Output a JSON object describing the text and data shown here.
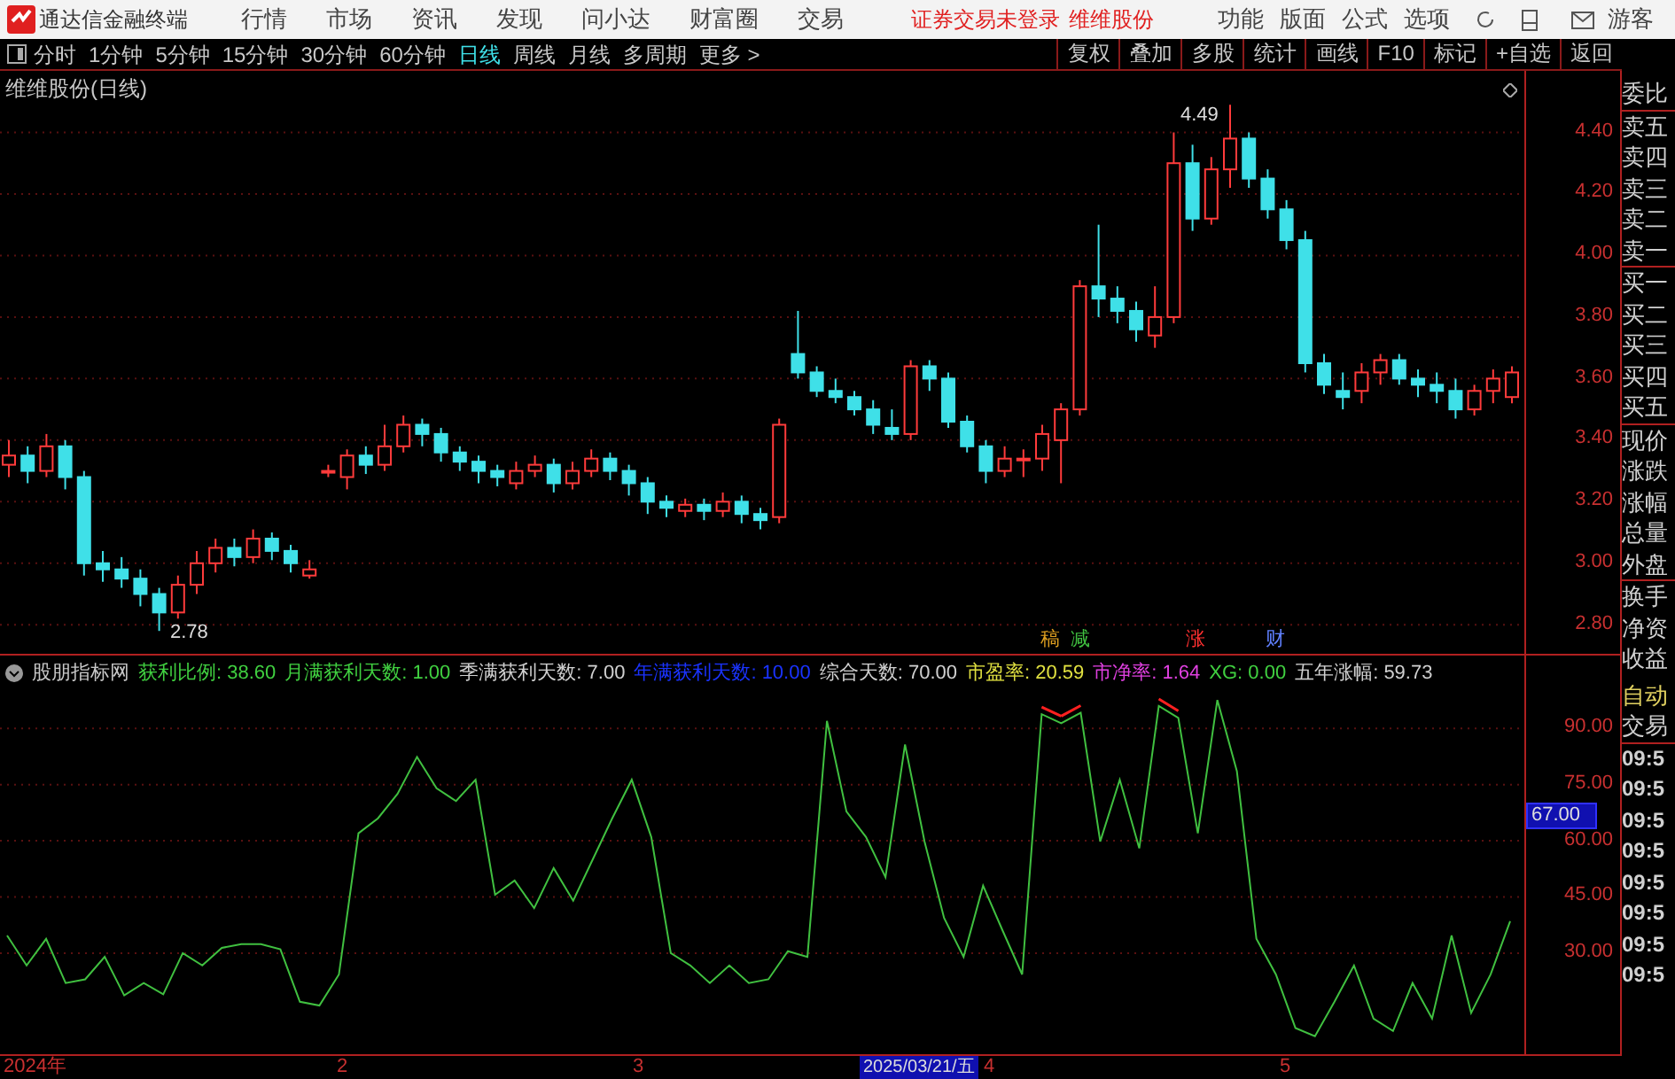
{
  "app": {
    "title": "通达信金融终端",
    "menus": [
      "行情",
      "市场",
      "资讯",
      "发现",
      "问小达",
      "财富圈",
      "交易"
    ],
    "status": [
      "证券交易未登录",
      "维维股份"
    ],
    "tools": [
      "功能",
      "版面",
      "公式",
      "选项"
    ],
    "user": "游客"
  },
  "periods": [
    {
      "label": "分时",
      "selected": false
    },
    {
      "label": "1分钟",
      "selected": false
    },
    {
      "label": "5分钟",
      "selected": false
    },
    {
      "label": "15分钟",
      "selected": false
    },
    {
      "label": "30分钟",
      "selected": false
    },
    {
      "label": "60分钟",
      "selected": false
    },
    {
      "label": "日线",
      "selected": true
    },
    {
      "label": "周线",
      "selected": false
    },
    {
      "label": "月线",
      "selected": false
    },
    {
      "label": "多周期",
      "selected": false
    },
    {
      "label": "更多 >",
      "selected": false
    }
  ],
  "actions": [
    "复权",
    "叠加",
    "多股",
    "统计",
    "画线",
    "F10",
    "标记",
    "+自选",
    "返回"
  ],
  "main_chart": {
    "title": "维维股份(日线)",
    "high_marker": "4.49",
    "low_marker": "2.78",
    "events": [
      {
        "label": "稿",
        "color": "#e0a020"
      },
      {
        "label": "减",
        "color": "#40c040"
      },
      {
        "label": "涨",
        "color": "#ff3030"
      },
      {
        "label": "财",
        "color": "#6080ff"
      }
    ],
    "chart_data": {
      "type": "candlestick",
      "grid": true,
      "ylim": [
        2.7,
        4.6
      ],
      "yticks": [
        {
          "value": 4.4,
          "label": "4.40"
        },
        {
          "value": 4.2,
          "label": "4.20"
        },
        {
          "value": 4.0,
          "label": "4.00"
        },
        {
          "value": 3.8,
          "label": "3.80"
        },
        {
          "value": 3.6,
          "label": "3.60"
        },
        {
          "value": 3.4,
          "label": "3.40"
        },
        {
          "value": 3.2,
          "label": "3.20"
        },
        {
          "value": 3.0,
          "label": "3.00"
        },
        {
          "value": 2.8,
          "label": "2.80"
        }
      ],
      "ohlc": [
        [
          3.32,
          3.4,
          3.28,
          3.35
        ],
        [
          3.35,
          3.38,
          3.26,
          3.3
        ],
        [
          3.3,
          3.42,
          3.28,
          3.38
        ],
        [
          3.38,
          3.4,
          3.24,
          3.28
        ],
        [
          3.28,
          3.3,
          2.96,
          3.0
        ],
        [
          3.0,
          3.04,
          2.94,
          2.98
        ],
        [
          2.98,
          3.02,
          2.92,
          2.95
        ],
        [
          2.95,
          2.98,
          2.86,
          2.9
        ],
        [
          2.9,
          2.92,
          2.78,
          2.84
        ],
        [
          2.84,
          2.96,
          2.82,
          2.93
        ],
        [
          2.93,
          3.04,
          2.9,
          3.0
        ],
        [
          3.0,
          3.08,
          2.97,
          3.05
        ],
        [
          3.05,
          3.08,
          2.99,
          3.02
        ],
        [
          3.02,
          3.11,
          3.0,
          3.08
        ],
        [
          3.08,
          3.1,
          3.01,
          3.04
        ],
        [
          3.04,
          3.06,
          2.97,
          3.0
        ],
        [
          2.96,
          3.01,
          2.95,
          2.98
        ],
        [
          3.3,
          3.32,
          3.28,
          3.3
        ],
        [
          3.28,
          3.37,
          3.24,
          3.35
        ],
        [
          3.35,
          3.38,
          3.29,
          3.32
        ],
        [
          3.32,
          3.45,
          3.3,
          3.38
        ],
        [
          3.38,
          3.48,
          3.36,
          3.45
        ],
        [
          3.45,
          3.47,
          3.38,
          3.42
        ],
        [
          3.42,
          3.44,
          3.33,
          3.36
        ],
        [
          3.36,
          3.38,
          3.3,
          3.33
        ],
        [
          3.33,
          3.35,
          3.26,
          3.3
        ],
        [
          3.3,
          3.32,
          3.25,
          3.28
        ],
        [
          3.26,
          3.33,
          3.24,
          3.3
        ],
        [
          3.3,
          3.35,
          3.28,
          3.32
        ],
        [
          3.32,
          3.34,
          3.23,
          3.26
        ],
        [
          3.26,
          3.33,
          3.24,
          3.3
        ],
        [
          3.3,
          3.37,
          3.28,
          3.34
        ],
        [
          3.34,
          3.36,
          3.27,
          3.3
        ],
        [
          3.3,
          3.32,
          3.22,
          3.26
        ],
        [
          3.26,
          3.28,
          3.16,
          3.2
        ],
        [
          3.2,
          3.22,
          3.15,
          3.18
        ],
        [
          3.17,
          3.21,
          3.15,
          3.19
        ],
        [
          3.19,
          3.21,
          3.14,
          3.17
        ],
        [
          3.17,
          3.23,
          3.15,
          3.2
        ],
        [
          3.2,
          3.22,
          3.13,
          3.16
        ],
        [
          3.16,
          3.18,
          3.11,
          3.14
        ],
        [
          3.15,
          3.47,
          3.13,
          3.45
        ],
        [
          3.68,
          3.82,
          3.6,
          3.62
        ],
        [
          3.62,
          3.64,
          3.54,
          3.56
        ],
        [
          3.56,
          3.6,
          3.52,
          3.54
        ],
        [
          3.54,
          3.56,
          3.48,
          3.5
        ],
        [
          3.5,
          3.53,
          3.42,
          3.45
        ],
        [
          3.44,
          3.5,
          3.4,
          3.42
        ],
        [
          3.42,
          3.66,
          3.4,
          3.64
        ],
        [
          3.64,
          3.66,
          3.56,
          3.6
        ],
        [
          3.6,
          3.62,
          3.44,
          3.46
        ],
        [
          3.46,
          3.48,
          3.36,
          3.38
        ],
        [
          3.38,
          3.4,
          3.26,
          3.3
        ],
        [
          3.3,
          3.38,
          3.28,
          3.34
        ],
        [
          3.34,
          3.37,
          3.28,
          3.34
        ],
        [
          3.34,
          3.45,
          3.3,
          3.42
        ],
        [
          3.4,
          3.52,
          3.26,
          3.5
        ],
        [
          3.5,
          3.92,
          3.48,
          3.9
        ],
        [
          3.9,
          4.1,
          3.8,
          3.86
        ],
        [
          3.86,
          3.9,
          3.78,
          3.82
        ],
        [
          3.82,
          3.85,
          3.72,
          3.76
        ],
        [
          3.74,
          3.9,
          3.7,
          3.8
        ],
        [
          3.8,
          4.4,
          3.78,
          4.3
        ],
        [
          4.3,
          4.36,
          4.08,
          4.12
        ],
        [
          4.12,
          4.32,
          4.1,
          4.28
        ],
        [
          4.28,
          4.49,
          4.22,
          4.38
        ],
        [
          4.38,
          4.4,
          4.22,
          4.25
        ],
        [
          4.25,
          4.28,
          4.12,
          4.15
        ],
        [
          4.15,
          4.18,
          4.02,
          4.05
        ],
        [
          4.05,
          4.08,
          3.62,
          3.65
        ],
        [
          3.65,
          3.68,
          3.55,
          3.58
        ],
        [
          3.56,
          3.62,
          3.5,
          3.54
        ],
        [
          3.56,
          3.65,
          3.52,
          3.62
        ],
        [
          3.62,
          3.68,
          3.58,
          3.66
        ],
        [
          3.66,
          3.68,
          3.58,
          3.6
        ],
        [
          3.6,
          3.63,
          3.54,
          3.58
        ],
        [
          3.58,
          3.62,
          3.52,
          3.56
        ],
        [
          3.56,
          3.6,
          3.47,
          3.5
        ],
        [
          3.5,
          3.58,
          3.48,
          3.56
        ],
        [
          3.56,
          3.63,
          3.52,
          3.6
        ],
        [
          3.54,
          3.64,
          3.52,
          3.62
        ]
      ]
    }
  },
  "indicator": {
    "name": "股朋指标网",
    "cursor_value": "67.00",
    "legend": [
      {
        "label": "获利比例: 38.60",
        "color": "#40d040"
      },
      {
        "label": "月满获利天数: 1.00",
        "color": "#40d040"
      },
      {
        "label": "季满获利天数: 7.00",
        "color": "#d0d0d0"
      },
      {
        "label": "年满获利天数: 10.00",
        "color": "#1a33ff"
      },
      {
        "label": "综合天数: 70.00",
        "color": "#d0d0d0"
      },
      {
        "label": "市盈率: 20.59",
        "color": "#e0e040"
      },
      {
        "label": "市净率: 1.64",
        "color": "#e040e0"
      },
      {
        "label": "XG: 0.00",
        "color": "#40d040"
      },
      {
        "label": "五年涨幅: 59.73",
        "color": "#d0d0d0"
      }
    ],
    "chart_data": {
      "type": "line",
      "grid": true,
      "ylim": [
        3,
        100
      ],
      "yticks": [
        {
          "value": 90,
          "label": "90.00"
        },
        {
          "value": 75,
          "label": "75.00"
        },
        {
          "value": 60,
          "label": "60.00"
        },
        {
          "value": 45,
          "label": "45.00"
        },
        {
          "value": 30,
          "label": "30.00"
        }
      ],
      "series": [
        {
          "color": "#40c040",
          "values": [
            34.7,
            26.7,
            33.8,
            22,
            23,
            29,
            18.7,
            22,
            19,
            30,
            26.7,
            31.4,
            32.4,
            32.4,
            31,
            17,
            16,
            24.3,
            62,
            66,
            72.5,
            82.4,
            74,
            70.6,
            76.3,
            45.6,
            49.4,
            42,
            52.7,
            44,
            55,
            66,
            76.3,
            61,
            30,
            26.7,
            22,
            26.7,
            22,
            23,
            30.5,
            29,
            92,
            67.8,
            61,
            50.3,
            85.7,
            59.8,
            39.4,
            29,
            48,
            36,
            24.3,
            93.8,
            91.4,
            94.2,
            59.8,
            76.3,
            58,
            96,
            92.8,
            62,
            97.6,
            78.6,
            33.8,
            24.3,
            10,
            7.8,
            17,
            26.7,
            12.5,
            9.2,
            22,
            12.5,
            34.7,
            14,
            24.3,
            38.5
          ]
        }
      ]
    }
  },
  "time_axis": [
    {
      "label": "2024年",
      "kind": "tick"
    },
    {
      "label": "2",
      "kind": "tick"
    },
    {
      "label": "3",
      "kind": "tick"
    },
    {
      "label": "2025/03/21/五",
      "kind": "cursor"
    },
    {
      "label": "4",
      "kind": "tick"
    },
    {
      "label": "5",
      "kind": "tick"
    }
  ],
  "side_panel": {
    "labels": [
      "委比",
      "卖五",
      "卖四",
      "卖三",
      "卖二",
      "卖一",
      "买一",
      "买二",
      "买三",
      "买四",
      "买五",
      "现价",
      "涨跌",
      "涨幅",
      "总量",
      "外盘",
      "换手",
      "净资",
      "收益"
    ],
    "mode": "自动",
    "section": "交易",
    "times": [
      "09:5",
      "09:5",
      "09:5",
      "09:5",
      "09:5",
      "09:5",
      "09:5",
      "09:5"
    ]
  }
}
